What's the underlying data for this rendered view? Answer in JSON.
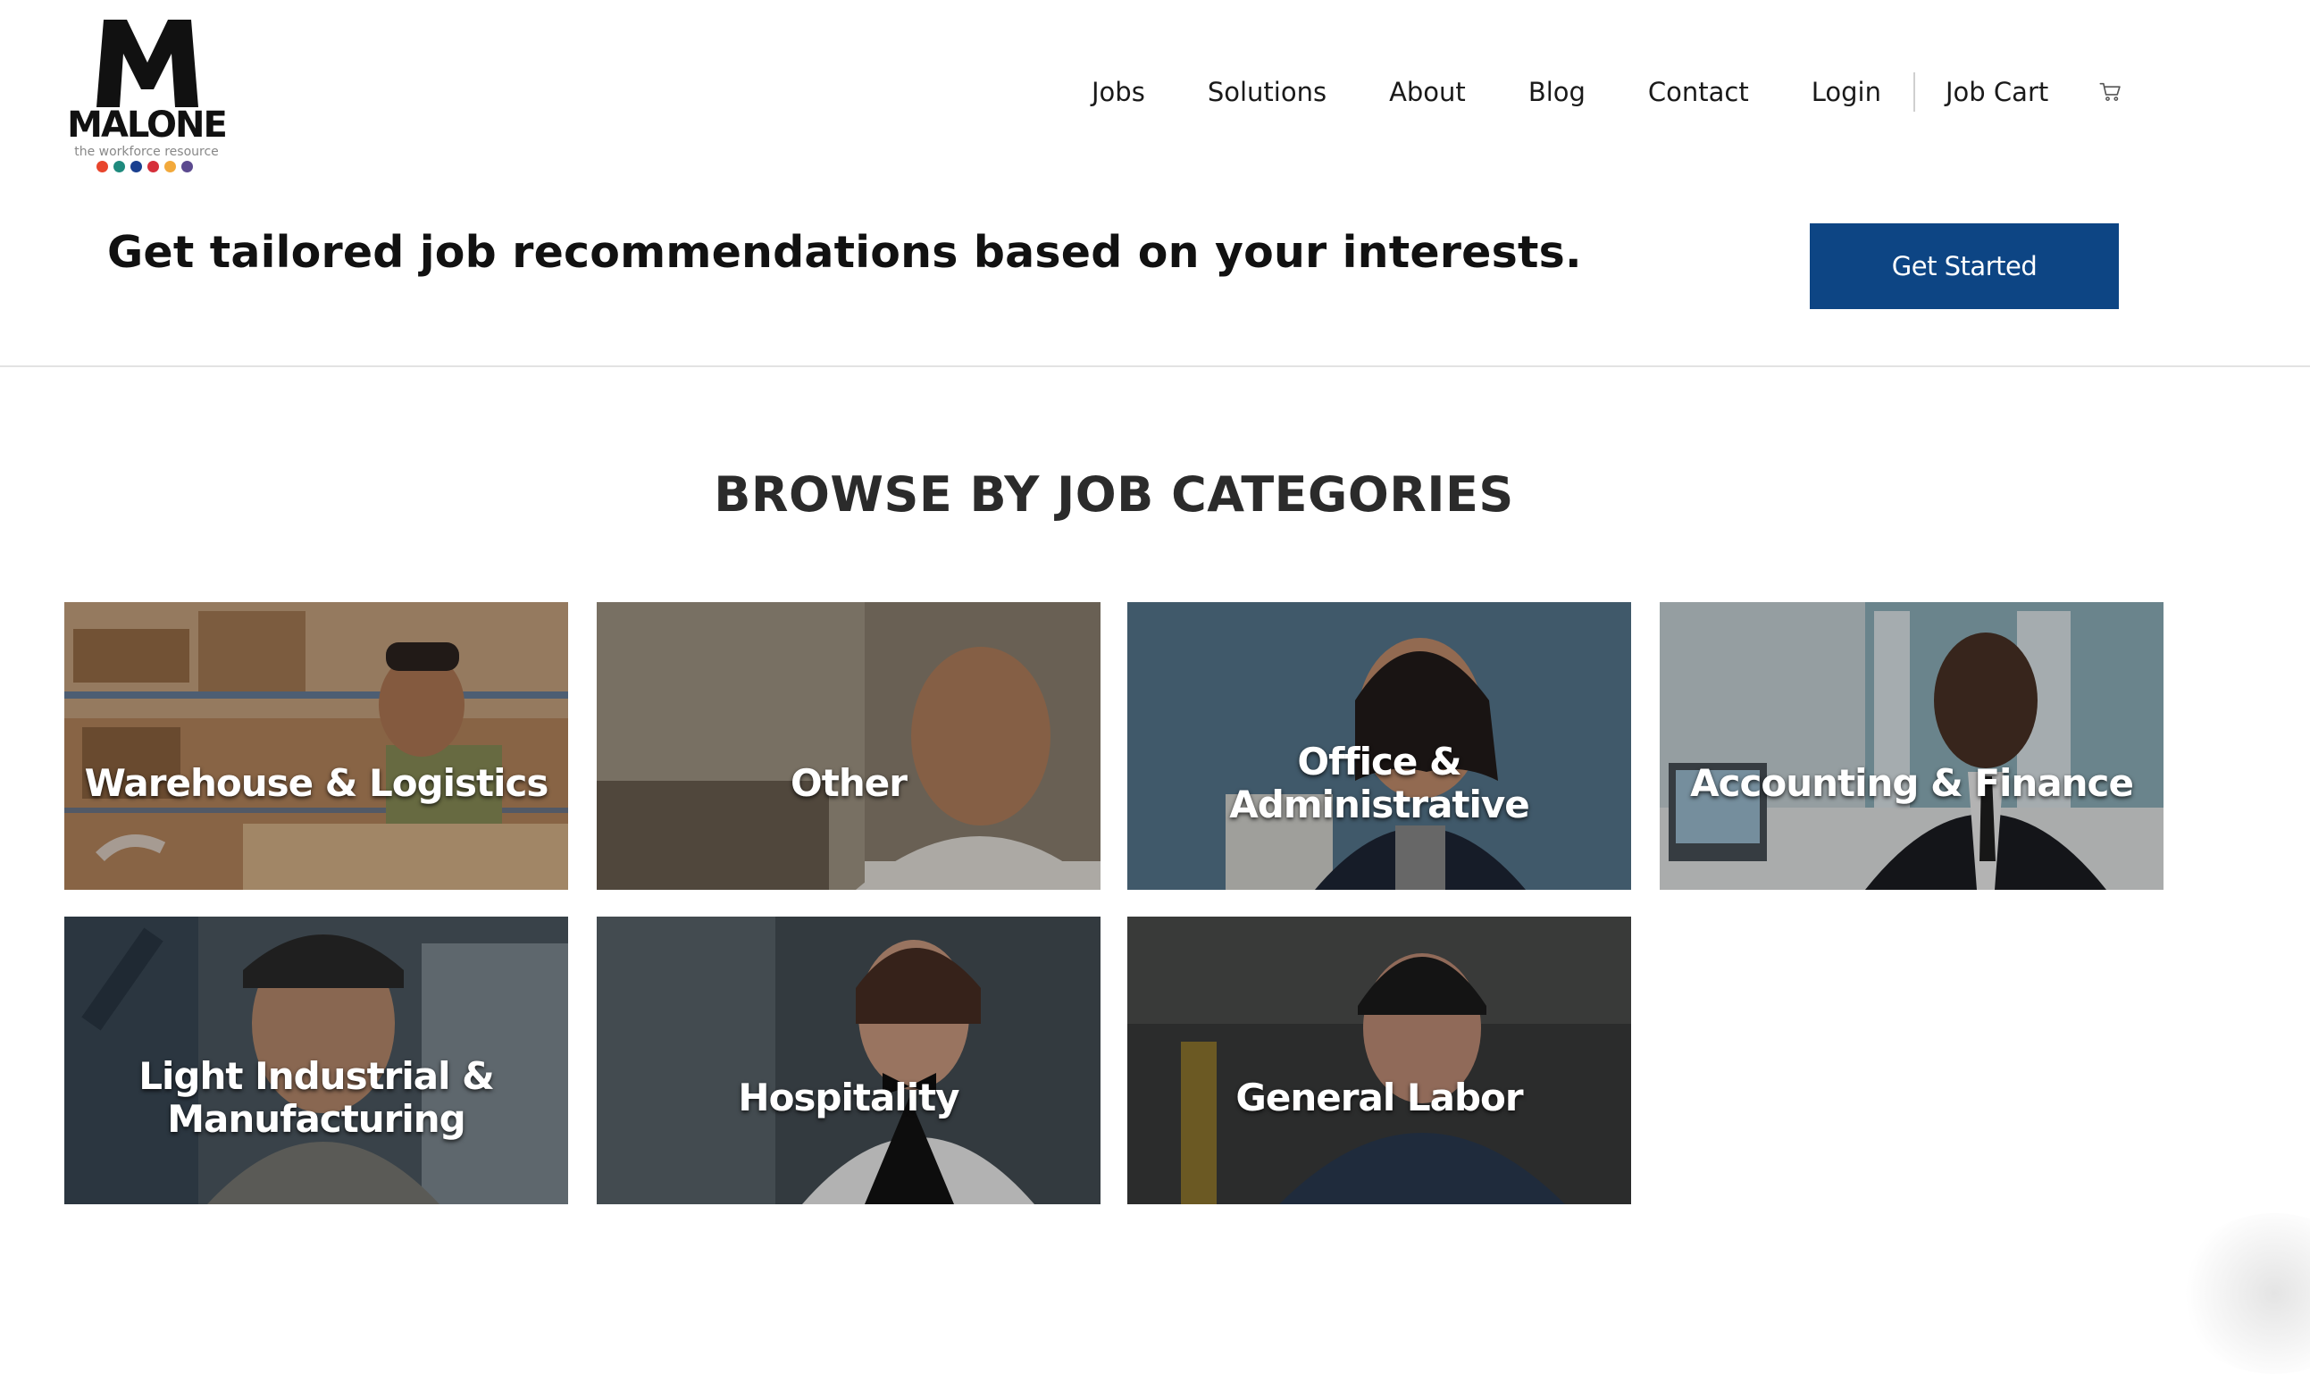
{
  "logo": {
    "name": "MALONE",
    "tagline": "the workforce resource",
    "dot_colors": [
      "#e8452c",
      "#1e8a7d",
      "#1a3f8f",
      "#d62f3a",
      "#f2a93b",
      "#5b4a8f"
    ]
  },
  "nav": {
    "items": [
      "Jobs",
      "Solutions",
      "About",
      "Blog",
      "Contact",
      "Login"
    ],
    "cart_label": "Job Cart",
    "cart_icon": "cart-icon"
  },
  "banner": {
    "text": "Get tailored job recommendations based on your interests.",
    "button_label": "Get Started",
    "button_color": "#0d4584"
  },
  "categories": {
    "title": "BROWSE BY JOB CATEGORIES",
    "items": [
      "Warehouse & Logistics",
      "Other",
      "Office & Administrative",
      "Accounting & Finance",
      "Light Industrial & Manufacturing",
      "Hospitality",
      "General Labor"
    ]
  }
}
